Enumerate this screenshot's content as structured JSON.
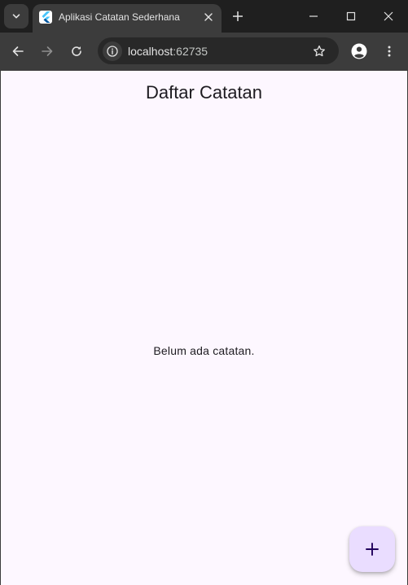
{
  "browser": {
    "tab": {
      "title": "Aplikasi Catatan Sederhana",
      "favicon": "flutter-icon"
    },
    "address": {
      "host": "localhost",
      "port": ":62735"
    },
    "icons": {
      "tab_search": "chevron-down-icon",
      "close_tab": "close-icon",
      "new_tab": "plus-icon",
      "minimize": "minimize-icon",
      "maximize": "maximize-icon",
      "close_window": "close-icon",
      "back": "arrow-left-icon",
      "forward": "arrow-right-icon",
      "reload": "reload-icon",
      "site_info": "info-icon",
      "bookmark": "star-icon",
      "profile": "profile-icon",
      "menu": "kebab-menu-icon"
    },
    "colors": {
      "frame": "#1f1f1f",
      "toolbar": "#3c3c3c",
      "omnibox": "#282828"
    }
  },
  "app": {
    "title": "Daftar Catatan",
    "empty_message": "Belum ada catatan.",
    "fab_icon": "plus-icon",
    "colors": {
      "background": "#fdf7ff",
      "fab": "#eaddff",
      "fab_icon": "#21005d",
      "text": "#1d1b20"
    }
  }
}
